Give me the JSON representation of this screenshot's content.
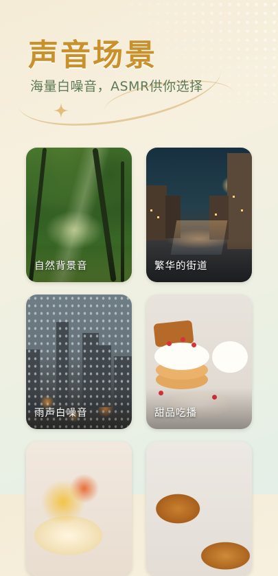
{
  "header": {
    "title": "声音场景",
    "subtitle": "海量白噪音，ASMR供你选择"
  },
  "scenes": [
    {
      "label": "自然背景音",
      "icon": "forest-photo"
    },
    {
      "label": "繁华的街道",
      "icon": "city-street-photo"
    },
    {
      "label": "雨声白噪音",
      "icon": "rainy-window-photo"
    },
    {
      "label": "甜品吃播",
      "icon": "pancake-dessert-photo"
    },
    {
      "label": "",
      "icon": "fruit-cake-photo"
    },
    {
      "label": "",
      "icon": "croissant-photo"
    }
  ],
  "colors": {
    "title": "#c9912c",
    "subtitle": "#5d7a55",
    "background": "#f4ecd6"
  }
}
